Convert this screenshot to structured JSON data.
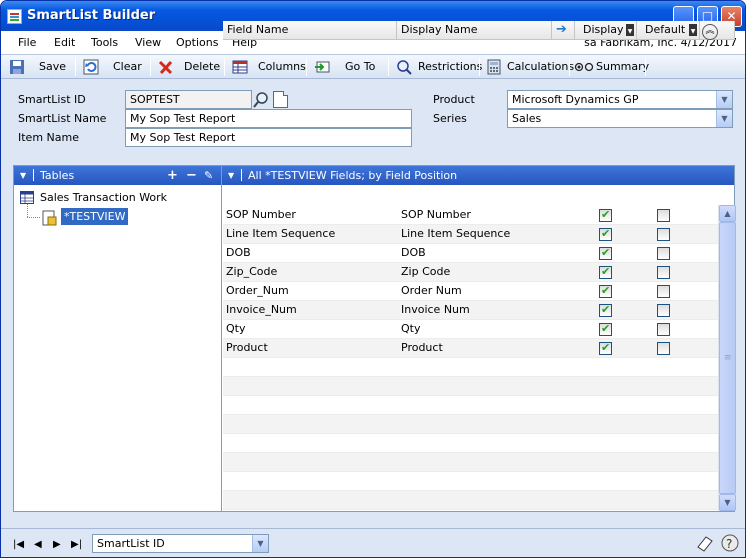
{
  "window": {
    "title": "SmartList Builder"
  },
  "menu": {
    "items": [
      "File",
      "Edit",
      "Tools",
      "View",
      "Options",
      "Help"
    ],
    "status": "sa  Fabrikam, Inc.  4/12/2017"
  },
  "toolbar": {
    "save": "Save",
    "clear": "Clear",
    "delete": "Delete",
    "columns": "Columns",
    "goto": "Go To",
    "restrictions": "Restrictions",
    "calculations": "Calculations",
    "summary": "Summary"
  },
  "form": {
    "smartlist_id_label": "SmartList ID",
    "smartlist_id": "SOPTEST",
    "smartlist_name_label": "SmartList Name",
    "smartlist_name": "My Sop Test Report",
    "item_name_label": "Item Name",
    "item_name": "My Sop Test Report",
    "product_label": "Product",
    "product": "Microsoft Dynamics GP",
    "series_label": "Series",
    "series": "Sales"
  },
  "tables": {
    "header": "Tables",
    "parent": "Sales Transaction Work",
    "child": "*TESTVIEW"
  },
  "fields": {
    "header": "All *TESTVIEW Fields; by Field Position",
    "columns": {
      "field_name": "Field Name",
      "display_name": "Display Name",
      "display": "Display",
      "default": "Default"
    },
    "rows": [
      {
        "field": "SOP Number",
        "display_name": "SOP Number",
        "display": true,
        "default": false
      },
      {
        "field": "Line Item Sequence",
        "display_name": "Line Item Sequence",
        "display": true,
        "default": false
      },
      {
        "field": "DOB",
        "display_name": "DOB",
        "display": true,
        "default": false
      },
      {
        "field": "Zip_Code",
        "display_name": "Zip Code",
        "display": true,
        "default": false
      },
      {
        "field": "Order_Num",
        "display_name": "Order Num",
        "display": true,
        "default": false
      },
      {
        "field": "Invoice_Num",
        "display_name": "Invoice Num",
        "display": true,
        "default": false
      },
      {
        "field": "Qty",
        "display_name": "Qty",
        "display": true,
        "default": false
      },
      {
        "field": "Product",
        "display_name": "Product",
        "display": true,
        "default": false
      }
    ]
  },
  "footer": {
    "sort_by": "SmartList ID"
  }
}
